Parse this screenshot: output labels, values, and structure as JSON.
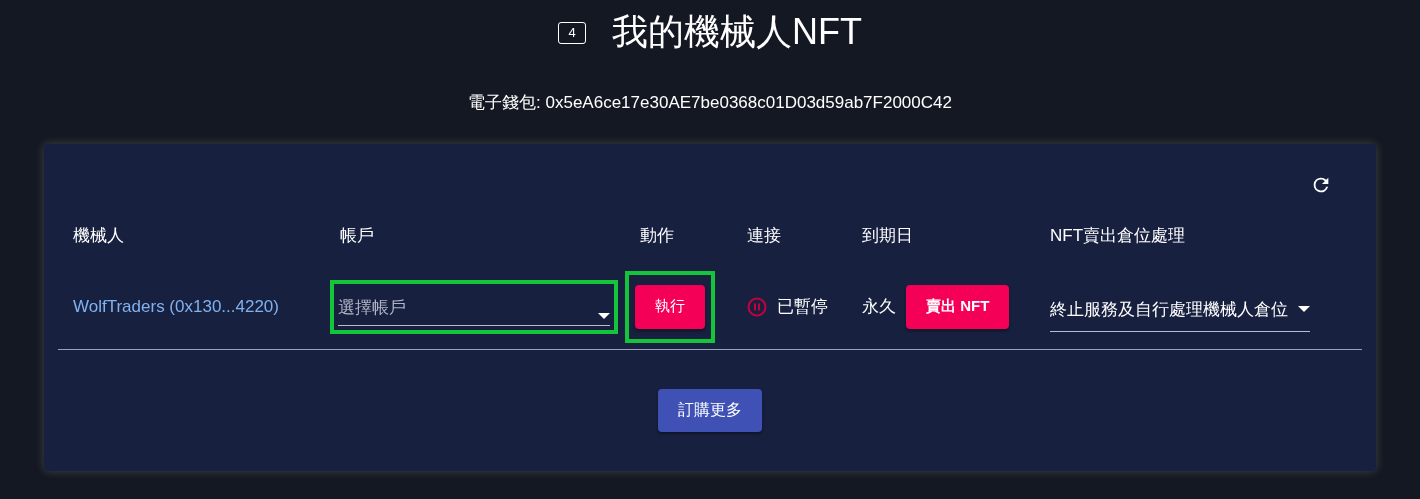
{
  "header": {
    "badge": "4",
    "title": "我的機械人NFT"
  },
  "wallet": {
    "label": "電子錢包:",
    "address": "0x5eA6ce17e30AE7be0368c01D03d59ab7F2000C42"
  },
  "table": {
    "columns": [
      "機械人",
      "帳戶",
      "動作",
      "連接",
      "到期日",
      "NFT賣出倉位處理"
    ],
    "rows": [
      {
        "robot": "WolfTraders (0x130...4220)",
        "account": {
          "placeholder": "選擇帳戶",
          "highlighted": true
        },
        "action": {
          "label": "執行",
          "highlighted": true
        },
        "connection": {
          "paused": true,
          "label": "已暫停"
        },
        "expiry": "永久",
        "sell_button": "賣出 NFT",
        "position_handling": "終止服務及自行處理機械人倉位"
      }
    ]
  },
  "order_more": "訂購更多"
}
